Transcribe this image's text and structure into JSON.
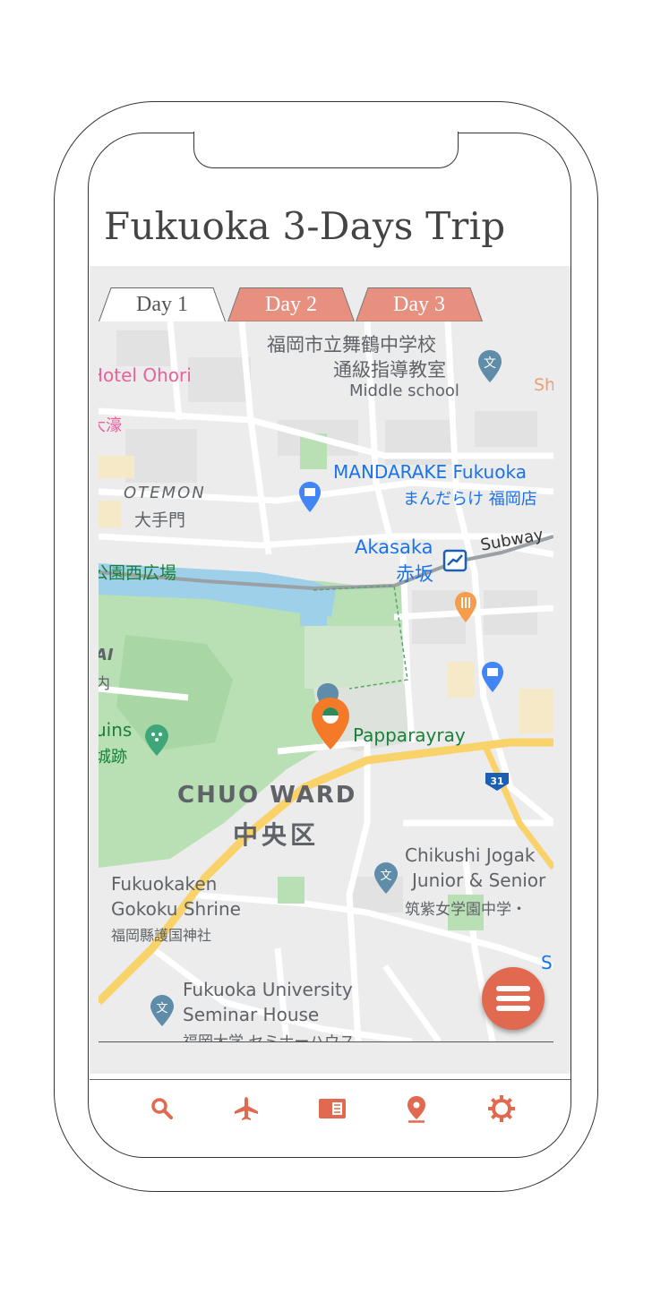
{
  "page": {
    "title": "Fukuoka 3-Days Trip"
  },
  "tabs": [
    {
      "label": "Day 1",
      "active": true
    },
    {
      "label": "Day 2",
      "active": false
    },
    {
      "label": "Day 3",
      "active": false
    }
  ],
  "map": {
    "labels": {
      "school_jp1": "福岡市立舞鶴中学校",
      "school_jp2": "通級指導教室",
      "school_en": "Middle school",
      "hotel": "Hotel Ohori",
      "hotel_jp": "大濠",
      "sh": "Sh",
      "otemon": "OTEMON",
      "otemon_jp": "大手門",
      "mandarake": "MANDARAKE Fukuoka",
      "mandarake_jp": "まんだらけ 福岡店",
      "akasaka": "Akasaka",
      "akasaka_jp": "赤坂",
      "subway": "Subway",
      "park_jp": "公園西広場",
      "ai": "AI",
      "nai": "内",
      "ruins": "uins",
      "ruins_jp": "城跡",
      "papparayray": "Papparayray",
      "route": "31",
      "ward": "CHUO WARD",
      "ward_jp": "中央区",
      "chikushi1": "Chikushi Jogak",
      "chikushi2": "Junior & Senior",
      "chikushi_jp": "筑紫女学園中学・",
      "shrine1": "Fukuokaken",
      "shrine2": "Gokoku Shrine",
      "shrine_jp": "福岡縣護国神社",
      "univ1": "Fukuoka University",
      "univ2": "Seminar House",
      "univ_jp": "福岡大学 セミナーハウス",
      "s_edge": "S"
    }
  },
  "fab": {
    "icon": "menu-icon"
  },
  "nav": [
    {
      "icon": "search-icon"
    },
    {
      "icon": "airplane-icon"
    },
    {
      "icon": "book-icon"
    },
    {
      "icon": "location-pin-icon"
    },
    {
      "icon": "gear-icon"
    }
  ],
  "colors": {
    "accent": "#e0694f",
    "tab_inactive": "#e8907f",
    "map_bg": "#ececec",
    "park": "#b9dfb5",
    "road_major": "#f9d26a",
    "water": "#9fd0ea"
  }
}
